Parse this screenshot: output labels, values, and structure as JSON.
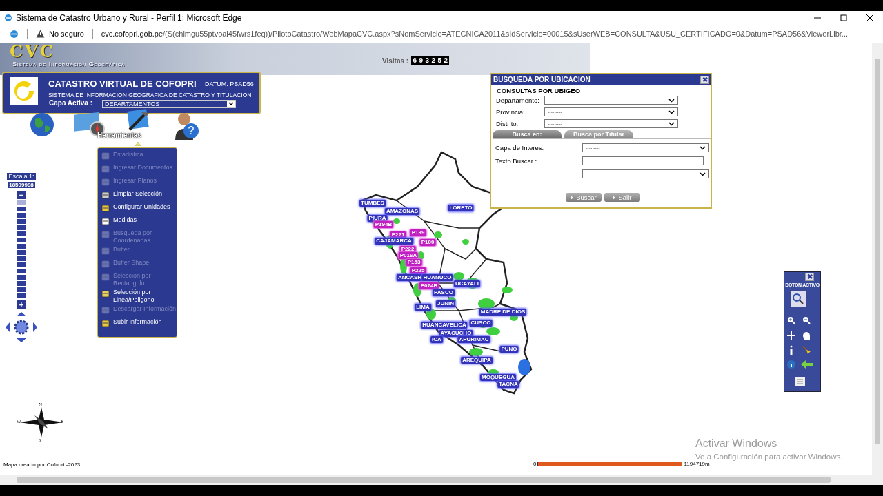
{
  "browser": {
    "title": "Sistema de Catastro Urbano y Rural - Perfil 1: Microsoft Edge",
    "security": "No seguro",
    "url_host": "cvc.cofopri.gob.pe",
    "url_rest": "/(S(chlmgu55ptvoal45fwrs1feq))/PilotoCatastro/WebMapaCVC.aspx?sNomServicio=ATECNICA2011&sIdServicio=00015&sUserWEB=CONSULTA&USU_CERTIFICADO=0&Datum=PSAD56&ViewerLibr..."
  },
  "banner": {
    "logo": "CVC",
    "subtitle": "Sistema de Información Geográfica",
    "visits_label": "Visitas :",
    "visits_digits": [
      "6",
      "9",
      "3",
      "2",
      "5",
      "2"
    ]
  },
  "header": {
    "title": "CATASTRO VIRTUAL DE COFOPRI",
    "datum": "DATUM: PSAD56",
    "subtitle": "SISTEMA DE INFORMACION GEOGRAFICA DE CATASTRO Y TITULACION",
    "layer_label": "Capa Activa :",
    "layer_value": "DEPARTAMENTOS"
  },
  "toolbar_label": "Herramientas",
  "tools_menu": [
    {
      "label": "Estadistica",
      "disabled": true
    },
    {
      "label": "Ingresar Documentos",
      "disabled": true
    },
    {
      "label": "Ingresar Planos",
      "disabled": true
    },
    {
      "label": "Limpiar Selección",
      "disabled": false
    },
    {
      "label": "Configurar Unidades",
      "disabled": false
    },
    {
      "label": "Medidas",
      "disabled": false
    },
    {
      "label": "Busqueda por\nCoordenadas",
      "disabled": true
    },
    {
      "label": "Buffer",
      "disabled": true
    },
    {
      "label": "Buffer Shape",
      "disabled": true
    },
    {
      "label": "Selección por\nRectangulo",
      "disabled": true
    },
    {
      "label": "Selección por\nLinea/Poligono",
      "disabled": false
    },
    {
      "label": "Descargar Información",
      "disabled": true
    },
    {
      "label": "Subir Información",
      "disabled": false
    }
  ],
  "scale": {
    "label": "Escala 1:",
    "value": "18599998",
    "zoom_out": "−",
    "zoom_in": "+",
    "level": 0
  },
  "dialog": {
    "title": "BUSQUEDA POR UBICACION",
    "section": "CONSULTAS POR UBIGEO",
    "ubigeo": [
      {
        "label": "Departamento:",
        "value": "----.----"
      },
      {
        "label": "Provincia:",
        "value": "----.----"
      },
      {
        "label": "Distrito:",
        "value": "----.----"
      }
    ],
    "tabs": [
      {
        "label": "Busca en:",
        "selected": true
      },
      {
        "label": "Busca por Titular",
        "selected": false
      }
    ],
    "layer_label": "Capa de Interes:",
    "layer_value": "----.----",
    "search_label": "Texto Buscar :",
    "buttons": [
      "Buscar",
      "Salir"
    ],
    "close": "✖"
  },
  "map_labels": [
    {
      "text": "TUMBES",
      "kind": "department"
    },
    {
      "text": "AMAZONAS",
      "kind": "department"
    },
    {
      "text": "PIURA",
      "kind": "department"
    },
    {
      "text": "P194B",
      "kind": "project"
    },
    {
      "text": "P221",
      "kind": "project"
    },
    {
      "text": "P139",
      "kind": "project"
    },
    {
      "text": "CAJAMARCA",
      "kind": "department"
    },
    {
      "text": "P100",
      "kind": "project"
    },
    {
      "text": "P222",
      "kind": "project"
    },
    {
      "text": "P016A",
      "kind": "project"
    },
    {
      "text": "P153",
      "kind": "project"
    },
    {
      "text": "P225",
      "kind": "project"
    },
    {
      "text": "ANCASH",
      "kind": "department"
    },
    {
      "text": "HUANUCO",
      "kind": "department"
    },
    {
      "text": "LORETO",
      "kind": "department"
    },
    {
      "text": "UCAYALI",
      "kind": "department"
    },
    {
      "text": "P074B",
      "kind": "project"
    },
    {
      "text": "PASCO",
      "kind": "department"
    },
    {
      "text": "JUNIN",
      "kind": "department"
    },
    {
      "text": "LIMA",
      "kind": "department"
    },
    {
      "text": "MADRE DE DIOS",
      "kind": "department"
    },
    {
      "text": "HUANCAVELICA",
      "kind": "department"
    },
    {
      "text": "CUSCO",
      "kind": "department"
    },
    {
      "text": "AYACUCHO",
      "kind": "department"
    },
    {
      "text": "ICA",
      "kind": "department"
    },
    {
      "text": "APURIMAC",
      "kind": "department"
    },
    {
      "text": "PUNO",
      "kind": "department"
    },
    {
      "text": "AREQUIPA",
      "kind": "department"
    },
    {
      "text": "MOQUEGUA",
      "kind": "department"
    },
    {
      "text": "TACNA",
      "kind": "department"
    }
  ],
  "help_glyph": "?",
  "nav_panel": {
    "title": "BOTON ACTIVO",
    "close": "✖"
  },
  "compass": [
    "N",
    "W",
    "E",
    "S"
  ],
  "footer": {
    "credit": "Mapa creado por Cofopri -2023",
    "scale_start": "0",
    "scale_end": "1194719m"
  },
  "activation": {
    "title": "Activar Windows",
    "message": "Ve a Configuración para activar Windows."
  }
}
